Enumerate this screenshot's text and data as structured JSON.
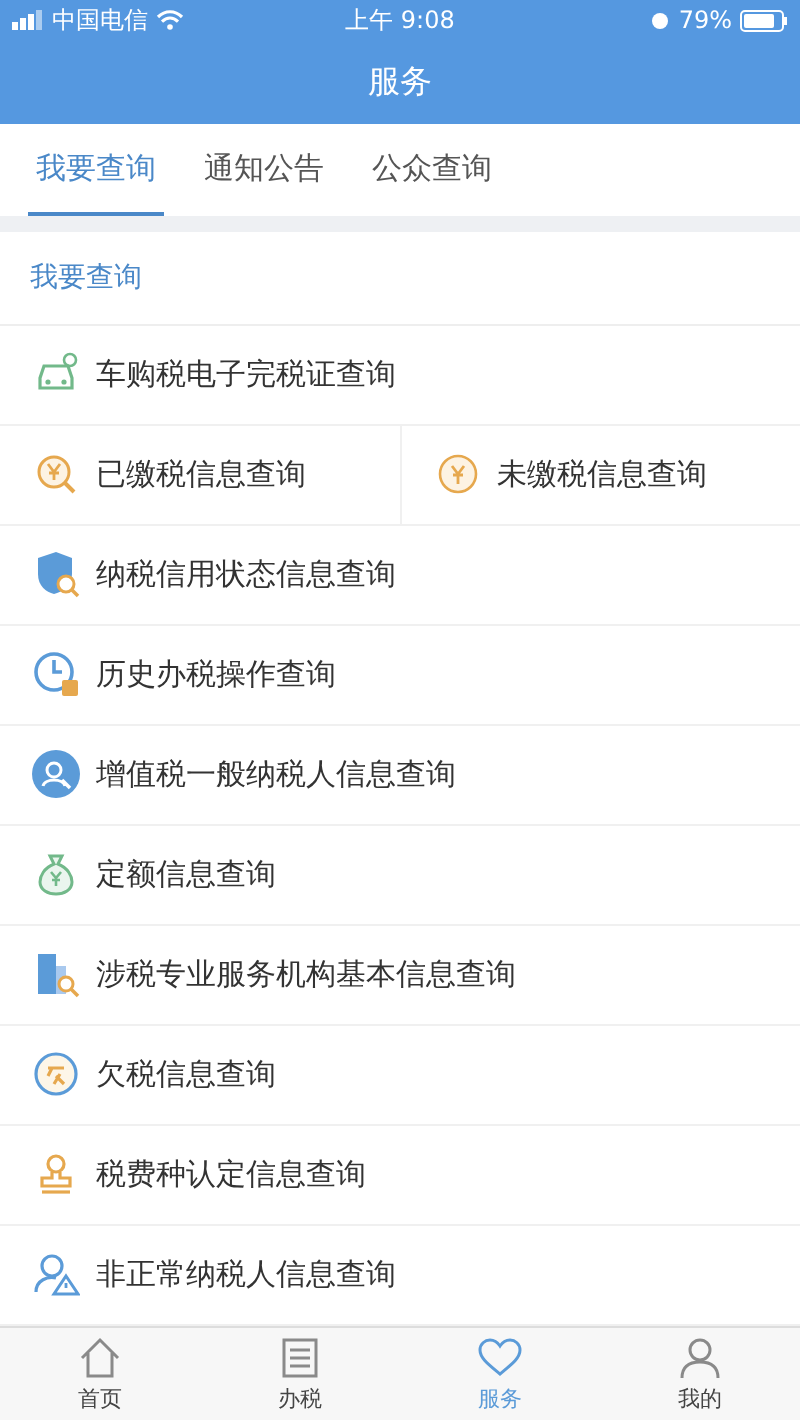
{
  "status_bar": {
    "carrier": "中国电信",
    "time": "上午 9:08",
    "battery": "79%"
  },
  "header": {
    "title": "服务"
  },
  "tabs": [
    {
      "label": "我要查询",
      "selected": true
    },
    {
      "label": "通知公告",
      "selected": false
    },
    {
      "label": "公众查询",
      "selected": false
    }
  ],
  "section_title": "我要查询",
  "rows": [
    {
      "items": [
        "车购税电子完税证查询"
      ]
    },
    {
      "items": [
        "已缴税信息查询",
        "未缴税信息查询"
      ]
    },
    {
      "items": [
        "纳税信用状态信息查询"
      ]
    },
    {
      "items": [
        "历史办税操作查询"
      ]
    },
    {
      "items": [
        "增值税一般纳税人信息查询"
      ]
    },
    {
      "items": [
        "定额信息查询"
      ]
    },
    {
      "items": [
        "涉税专业服务机构基本信息查询"
      ]
    },
    {
      "items": [
        "欠税信息查询"
      ]
    },
    {
      "items": [
        "税费种认定信息查询"
      ]
    },
    {
      "items": [
        "非正常纳税人信息查询"
      ]
    }
  ],
  "tab_bar": [
    {
      "label": "首页",
      "selected": false
    },
    {
      "label": "办税",
      "selected": false
    },
    {
      "label": "服务",
      "selected": true
    },
    {
      "label": "我的",
      "selected": false
    }
  ]
}
